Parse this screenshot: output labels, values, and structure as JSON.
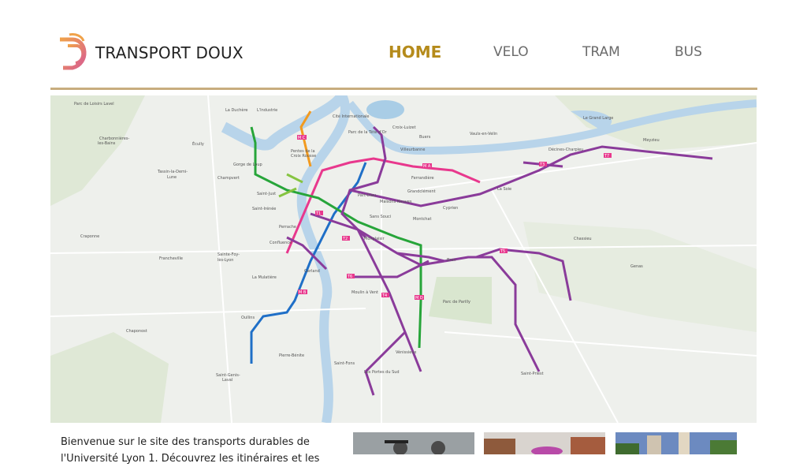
{
  "brand": {
    "name": "TRANSPORT DOUX"
  },
  "nav": {
    "items": [
      {
        "label": "HOME",
        "active": true
      },
      {
        "label": "VELO",
        "active": false
      },
      {
        "label": "TRAM",
        "active": false
      },
      {
        "label": "BUS",
        "active": false
      }
    ]
  },
  "map": {
    "places": [
      "Parc de Loisirs Lavel",
      "La Duchère",
      "L'Industrie",
      "Cité Internationale",
      "Croix-Luizet",
      "Buers",
      "Villeurbanne",
      "Écully",
      "Pentes de la Croix Rousse",
      "Gorge de Loup",
      "Champvert",
      "Tassin-la-Demi-Lune",
      "Charbonnières-les-Bains",
      "Saint-Just",
      "Saint-Irénée",
      "Perrache",
      "Confluence",
      "Gerland",
      "Monplaisir",
      "Montchat",
      "Sans Souci",
      "Grandclément",
      "Maisons Neuves",
      "Cyprien",
      "Ferrandière",
      "Part-Dieu",
      "La Soie",
      "Vaulx-en-Velin",
      "Décines-Charpieu",
      "Meyzieu",
      "Le Grand Large",
      "Chassieu",
      "Genas",
      "Bron",
      "Parc de Parilly",
      "Saint-Priest",
      "Vénissieux",
      "Saint-Fons",
      "Pierre-Bénite",
      "Oullins",
      "Saint-Genis-Laval",
      "Francheville",
      "Sainte-Foy-lès-Lyon",
      "La Mulatière",
      "Craponne",
      "Chaponost",
      "Moulin à Vent",
      "Les Portes du Sud",
      "Parc de la Tête d'Or"
    ],
    "line_labels": [
      "T1",
      "T2",
      "T3",
      "T4",
      "T5",
      "T6",
      "T7",
      "M A",
      "M B",
      "M C",
      "M D"
    ],
    "colors": {
      "tram": "#8a3b9a",
      "metro_a": "#e8388d",
      "metro_b": "#1f6fc7",
      "metro_c": "#f29a1f",
      "metro_d": "#27a53a",
      "funicular": "#86c441",
      "river": "#b8d4ea"
    }
  },
  "content": {
    "welcome_text": "Bienvenue sur le site des transports durables de l'Université Lyon 1. Découvrez les itinéraires et les"
  },
  "gallery": [
    {
      "alt": "bike-photo"
    },
    {
      "alt": "tram-photo"
    },
    {
      "alt": "city-photo"
    }
  ]
}
